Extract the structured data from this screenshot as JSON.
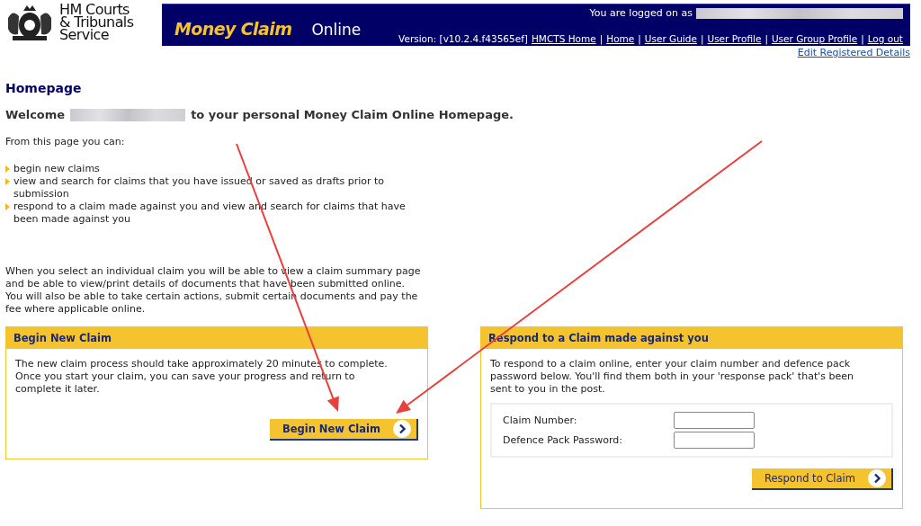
{
  "logo": {
    "lines": [
      "HM Courts",
      "& Tribunals",
      "Service"
    ]
  },
  "banner": {
    "title": "Money Claim",
    "subtitle": "Online",
    "logged_on_label": "You are logged on as",
    "version": "Version: [v10.2.4.f43565ef]",
    "nav_links": [
      "HMCTS Home",
      "Home",
      "User Guide",
      "User Profile",
      "User Group Profile",
      "Log out"
    ],
    "separator": "|"
  },
  "edit_link": "Edit Registered Details",
  "page_title": "Homepage",
  "welcome": {
    "before": "Welcome",
    "after": "to your personal Money Claim Online Homepage."
  },
  "intro": "From this page you can:",
  "bullets": [
    "begin new claims",
    "view and search for claims that you have issued or saved as drafts prior to submission",
    "respond to a claim made against you and view and search for claims that have been made against you"
  ],
  "details": "When you select an individual claim you will be able to view a claim summary page and be able to view/print details of documents that have been submitted online. You will also be able to take certain actions, submit certain documents and pay the fee where applicable online.",
  "panels": [
    {
      "kind": "begin",
      "title": "Begin New Claim",
      "text": "The new claim process should take approximately 20 minutes to complete. Once you start your claim, you can save your progress and return to complete it later.",
      "button": "Begin New Claim"
    },
    {
      "kind": "respond",
      "title": "Respond to a Claim made against you",
      "text": "To respond to a claim online, enter your claim number and defence pack password below. You'll find them both in your 'response pack' that's been sent to you in the post.",
      "fields": [
        {
          "label": "Claim Number:"
        },
        {
          "label": "Defence Pack Password:"
        }
      ],
      "button": "Respond to Claim"
    }
  ]
}
